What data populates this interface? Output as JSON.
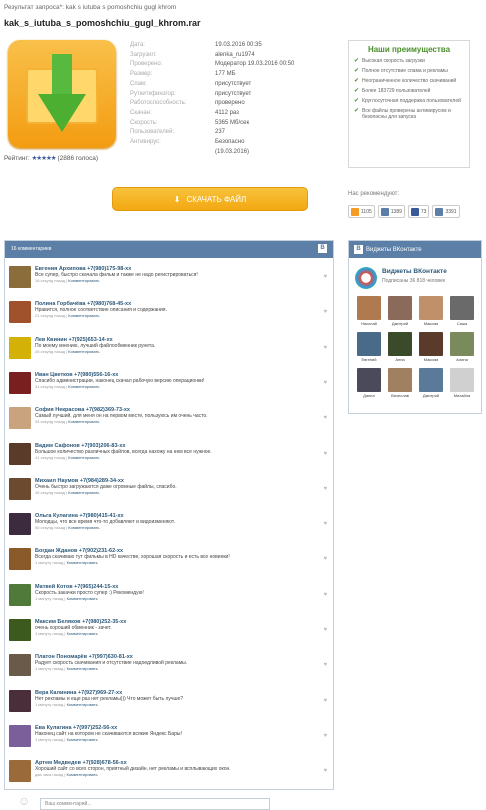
{
  "result_line": "Результат запроса*: kak s iutuba s pomoshchiu gugl khrom",
  "file_title": "kak_s_iutuba_s_pomoshchiu_gugl_khrom.rar",
  "info": [
    {
      "k": "Дата:",
      "v": "19.03.2016 00:35"
    },
    {
      "k": "Загрузил:",
      "v": "alenka_ru1974"
    },
    {
      "k": "Проверено:",
      "v": "Модератор 19.03.2016 00:50"
    },
    {
      "k": "Размер:",
      "v": "177 МБ"
    },
    {
      "k": "Спам:",
      "v": "присутствует"
    },
    {
      "k": "Руткиткфинзгор:",
      "v": "присутствует"
    },
    {
      "k": "Работоспособность:",
      "v": "проверено"
    },
    {
      "k": "Скачан:",
      "v": "4112 раз"
    },
    {
      "k": "Скорость:",
      "v": "5365 Мб/сек"
    },
    {
      "k": "Пользователей:",
      "v": "237"
    },
    {
      "k": "Антивирус:",
      "v": "Безопасно"
    },
    {
      "k": "",
      "v": "(19.03.2016)"
    }
  ],
  "rating": {
    "label": "Рейтинг:",
    "stars": "★★★★★",
    "votes": "(2886 голоса)"
  },
  "download_label": "СКАЧАТЬ ФАЙЛ",
  "advantages": {
    "title": "Наши преимущества",
    "items": [
      "Высокая скорость загрузки",
      "Полное отсутствие спама и рекламы",
      "Неограниченное количество скачиваний",
      "Более 183729 пользователей",
      "Круглосуточная поддержка пользователей",
      "Все файлы проверены антивирусом и безопасны для запуска"
    ]
  },
  "recommend_label": "Нас рекомендуют:",
  "shares": [
    {
      "icon": "ok-icon",
      "count": "1105",
      "color": "#f59a23"
    },
    {
      "icon": "vk-icon",
      "count": "1389",
      "color": "#5b7fa6"
    },
    {
      "icon": "facebook-icon",
      "count": "73",
      "color": "#3b5998"
    },
    {
      "icon": "vk-square-icon",
      "count": "3391",
      "color": "#5b7fa6"
    }
  ],
  "comments_header": "16 комментариев",
  "comments": [
    {
      "name": "Евгения Архипова +7(980)175-98-xx",
      "text": "Все супер, быстро скачала фильм и также не надо регистрироваться!",
      "meta": "16 секунд назад",
      "reply": "Комментировать",
      "color": "#8a6d3b"
    },
    {
      "name": "Полина Горбачёва +7(980)768-45-xx",
      "text": "Нравится, полное соответствие описания и содержания.",
      "meta": "21 секунд назад",
      "reply": "Комментировать",
      "color": "#a0522d"
    },
    {
      "name": "Лев Квинин +7(925)653-14-xx",
      "text": "По моему мнению, лучший файлообменник рунета.",
      "meta": "26 секунд назад",
      "reply": "Комментировать",
      "color": "#d4b106"
    },
    {
      "name": "Иван Цветков +7(980)556-16-xx",
      "text": "Спасибо администрации, наконец скачал рабочую версию операционки!",
      "meta": "31 секунд назад",
      "reply": "Комментировать",
      "color": "#7a1f1f"
    },
    {
      "name": "София Некрасова +7(982)369-73-xx",
      "text": "Самый лучший, для меня он на первом месте, пользуюсь им очень часто.",
      "meta": "34 секунд назад",
      "reply": "Комментировать",
      "color": "#c9a27e"
    },
    {
      "name": "Вадим Сафонов +7(903)206-83-xx",
      "text": "Большое количество различных файлов, всегда нахожу на нем все нужное.",
      "meta": "41 секунд назад",
      "reply": "Комментировать",
      "color": "#5a3b2a"
    },
    {
      "name": "Михаил Наумов +7(984)289-34-xx",
      "text": "Очень быстро загружаются даже огромные файлы, спасибо.",
      "meta": "45 секунд назад",
      "reply": "Комментировать",
      "color": "#6b4a2f"
    },
    {
      "name": "Ольга Кулагина +7(980)415-41-xx",
      "text": "Молодцы, что все время что-то добавляют и видоизменяют.",
      "meta": "55 секунд назад",
      "reply": "Комментировать",
      "color": "#3c2a3e"
    },
    {
      "name": "Богдан Жданов +7(902)231-62-xx",
      "text": "Всегда скачиваю тут фильмы в HD качестве, хорошая скорость и есть все новинки!",
      "meta": "1 минуту назад",
      "reply": "Комментировать",
      "color": "#8b5a2b"
    },
    {
      "name": "Матвей Котов +7(965)244-15-xx",
      "text": "Скорость закачки просто супер :) Рекомендую!",
      "meta": "1 минуту назад",
      "reply": "Комментировать",
      "color": "#4f7a3a"
    },
    {
      "name": "Максим Беляков +7(980)252-35-xx",
      "text": "очень хороший обменник - зачет.",
      "meta": "1 минуту назад",
      "reply": "Комментировать",
      "color": "#3d5a1e"
    },
    {
      "name": "Платон Пономарёв +7(997)630-81-xx",
      "text": "Радует скорость скачивания и отсутствие надоедливой рекламы.",
      "meta": "1 минуту назад",
      "reply": "Комментировать",
      "color": "#6a5a4a"
    },
    {
      "name": "Вера Калинина +7(927)969-27-xx",
      "text": "Нет рекламы и еще раз нет рекламы))) Что может быть лучше?",
      "meta": "1 минуту назад",
      "reply": "Комментировать",
      "color": "#4a2f3a"
    },
    {
      "name": "Ева Кулагина +7(997)252-56-xx",
      "text": "Наконец сайт на котором не скачиваются всякие Яндекс Бары!",
      "meta": "1 минуту назад",
      "reply": "Комментировать",
      "color": "#7a5f9a"
    },
    {
      "name": "Артем Медведев +7(928)678-56-xx",
      "text": "Хороший сайт со всех сторон, приятный дизайн, нет рекламы и всплывающих окон.",
      "meta": "два часа назад",
      "reply": "Комментировать",
      "color": "#9a6a3a"
    }
  ],
  "comment_placeholder": "Ваш комментарий...",
  "vk": {
    "header": "Виджеты ВКонтакте",
    "title": "Виджеты ВКонтакте",
    "subscribers": "Подписаны 36 818 человек",
    "members": [
      {
        "name": "Николай",
        "color": "#b07a50"
      },
      {
        "name": "Дмитрий",
        "color": "#8a6a5a"
      },
      {
        "name": "Максим",
        "color": "#c0906a"
      },
      {
        "name": "Саша",
        "color": "#6a6a6a"
      },
      {
        "name": "Евгений",
        "color": "#4a6a8a"
      },
      {
        "name": "Анна",
        "color": "#3a4a2a"
      },
      {
        "name": "Максим",
        "color": "#5a3a2a"
      },
      {
        "name": "Алина",
        "color": "#7a8a5a"
      },
      {
        "name": "Данил",
        "color": "#4a4a5a"
      },
      {
        "name": "Вячеслав",
        "color": "#a08060"
      },
      {
        "name": "Дмитрий",
        "color": "#5a7a9a"
      },
      {
        "name": "Михайла",
        "color": "#d0d0d0"
      }
    ]
  },
  "colors": {
    "accent": "#5b7fa6",
    "button": "#f3a812",
    "green": "#4a8f2a"
  }
}
